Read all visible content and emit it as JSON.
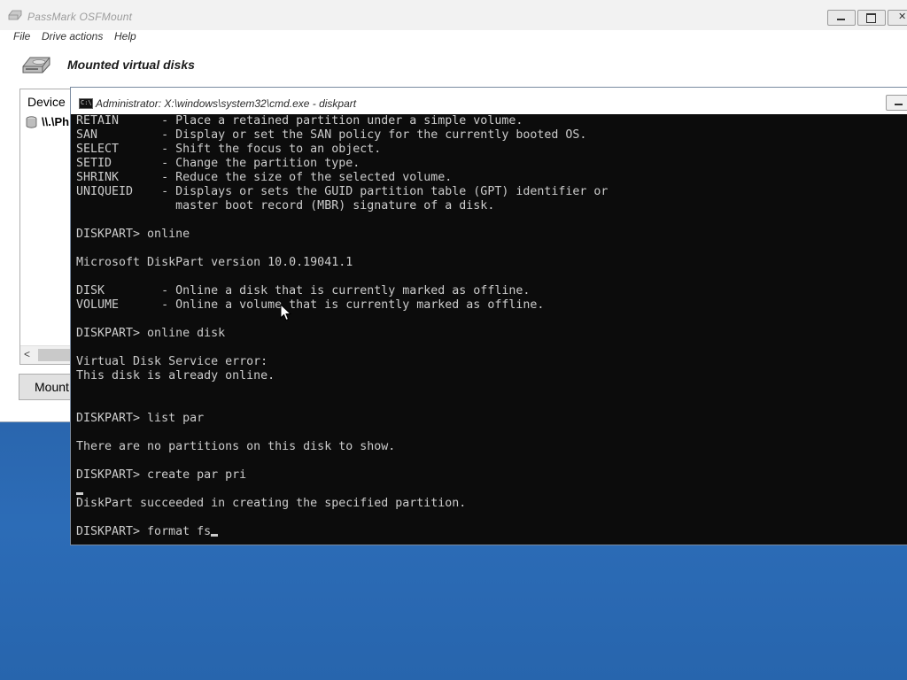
{
  "osfmount": {
    "title": "PassMark OSFMount",
    "menu": [
      "File",
      "Drive actions",
      "Help"
    ],
    "section_title": "Mounted virtual disks",
    "device_column": "Device",
    "device_row": "\\\\.\\Ph",
    "mount_button": "Mount",
    "icons": [
      "hdd-icon",
      "minimize-icon",
      "maximize-icon",
      "close-icon",
      "scroll-left-arrow-icon"
    ]
  },
  "cmd": {
    "title": "Administrator: X:\\windows\\system32\\cmd.exe - diskpart",
    "icon_label": "C:\\",
    "lines": [
      "RETAIN      - Place a retained partition under a simple volume.",
      "SAN         - Display or set the SAN policy for the currently booted OS.",
      "SELECT      - Shift the focus to an object.",
      "SETID       - Change the partition type.",
      "SHRINK      - Reduce the size of the selected volume.",
      "UNIQUEID    - Displays or sets the GUID partition table (GPT) identifier or",
      "              master boot record (MBR) signature of a disk.",
      "",
      "DISKPART> online",
      "",
      "Microsoft DiskPart version 10.0.19041.1",
      "",
      "DISK        - Online a disk that is currently marked as offline.",
      "VOLUME      - Online a volume that is currently marked as offline.",
      "",
      "DISKPART> online disk",
      "",
      "Virtual Disk Service error:",
      "This disk is already online.",
      "",
      "",
      "DISKPART> list par",
      "",
      "There are no partitions on this disk to show.",
      "",
      "DISKPART> create par pri",
      "",
      "DiskPart succeeded in creating the specified partition.",
      "",
      "DISKPART> format fs"
    ]
  },
  "colors": {
    "desktop": "#2f6db5",
    "console_bg": "#0c0c0c",
    "console_text": "#cccccc"
  }
}
